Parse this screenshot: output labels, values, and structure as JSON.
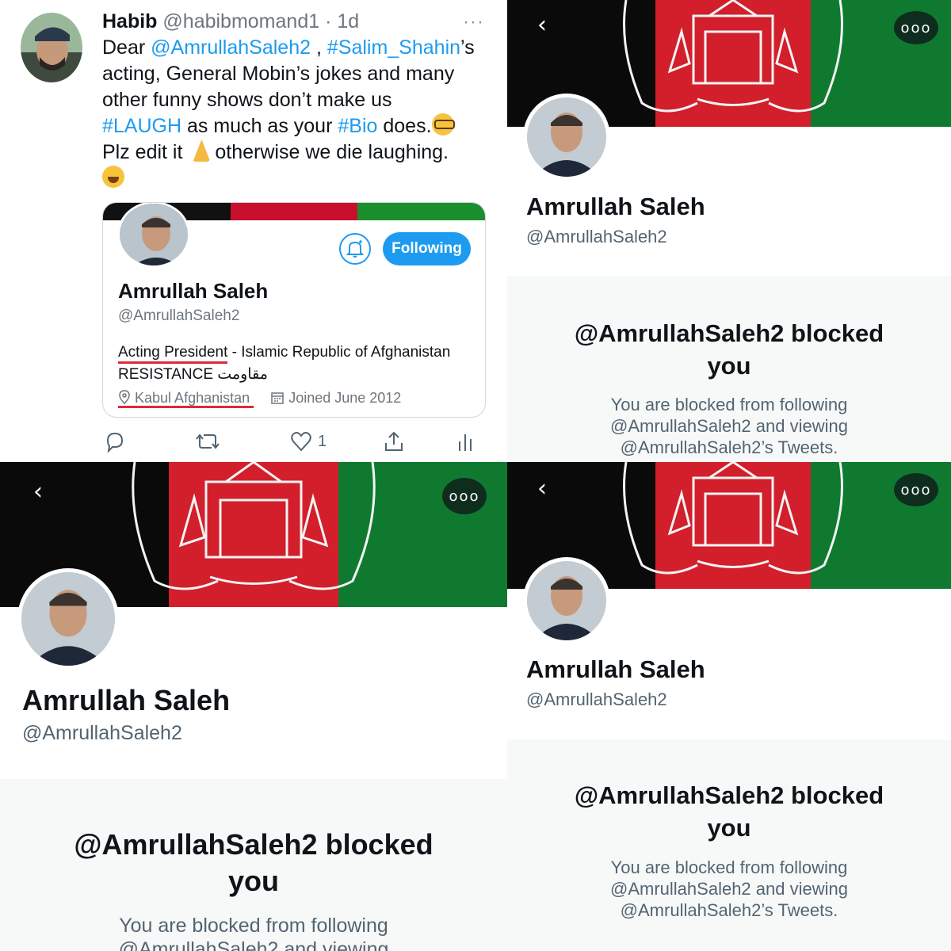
{
  "tweet": {
    "author_name": "Habib",
    "author_handle": "@habibmomand1",
    "separator": "·",
    "age": "1d",
    "more": "···",
    "text": {
      "l1_a": "Dear ",
      "l1_mention": "@AmrullahSaleh2",
      "l1_b": " , ",
      "l1_tag": "#Salim_Shahin",
      "l1_c": "’s",
      "l2": "acting, General Mobin’s jokes and many",
      "l3": "other funny shows don’t make us",
      "l4_tag": "#LAUGH",
      "l4_a": " as much as your ",
      "l4_tag2": "#Bio",
      "l4_b": " does.",
      "l5_a": "Plz edit it ",
      "l5_b": "otherwise we die laughing."
    },
    "emojis": [
      "nerd-face",
      "folded-hands",
      "face-with-tears-of-joy"
    ],
    "card": {
      "name": "Amrullah Saleh",
      "handle": "@AmrullahSaleh2",
      "follow_label": "Following",
      "bio_underlined": "Acting President",
      "bio_rest": " - Islamic Republic of Afghanistan",
      "bio_line2": "RESISTANCE مقاومت",
      "location": "Kabul Afghanistan",
      "joined": "Joined June 2012",
      "underline_color": "#e0283b"
    },
    "actions": {
      "like_count": "1"
    }
  },
  "profile": {
    "name": "Amrullah Saleh",
    "handle": "@AmrullahSaleh2",
    "blocked_title_l1": "@AmrullahSaleh2 blocked",
    "blocked_title_l2": "you",
    "blocked_sub_l1": "You are blocked from following",
    "blocked_sub_l2": "@AmrullahSaleh2 and viewing",
    "blocked_sub_l3": "@AmrullahSaleh2’s Tweets.",
    "back_icon": "‹",
    "more_icon": "ooo"
  },
  "colors": {
    "accent": "#1d9bf0",
    "flag_black": "#0a0a0a",
    "flag_red": "#d21f2b",
    "flag_green": "#0f7a2f",
    "blocked_bg": "#f7f9f9"
  }
}
